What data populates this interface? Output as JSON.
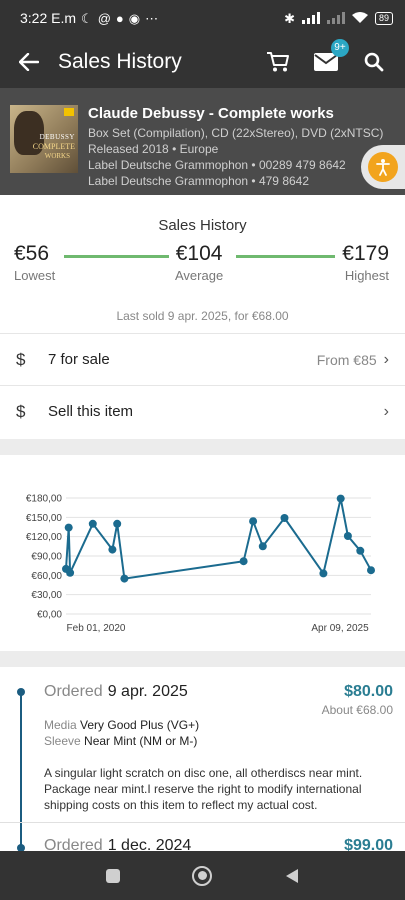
{
  "status_bar": {
    "time": "3:22 E.m",
    "overflow": "⋯",
    "battery": "89",
    "icons": [
      "moon-icon",
      "at-icon",
      "chat-icon",
      "record-icon",
      "bluetooth-icon",
      "signal-icon",
      "signal-icon",
      "wifi-icon",
      "battery-icon"
    ]
  },
  "app_bar": {
    "title": "Sales History",
    "notifications_badge": "9+",
    "icons": [
      "back-arrow-icon",
      "cart-icon",
      "mail-icon",
      "search-icon"
    ]
  },
  "release": {
    "title": "Claude Debussy - Complete works",
    "format": "Box Set (Compilation), CD (22xStereo), DVD (2xNTSC)",
    "released": "Released 2018 • Europe",
    "label1": "Label Deutsche Grammophon • 00289 479 8642",
    "label2": "Label Deutsche Grammophon • 479 8642",
    "cover_text": [
      "DEBUSSY",
      "COMPLETE",
      "WORKS"
    ]
  },
  "summary": {
    "heading": "Sales History",
    "lowest_value": "€56",
    "lowest_label": "Lowest",
    "average_value": "€104",
    "average_label": "Average",
    "highest_value": "€179",
    "highest_label": "Highest",
    "last_sold": "Last sold 9 apr. 2025, for €68.00",
    "accent_color": "#6fb96f"
  },
  "for_sale": {
    "icon": "$",
    "text": "7 for sale",
    "right": "From €85",
    "chevron": "›"
  },
  "sell": {
    "icon": "$",
    "text": "Sell this item",
    "chevron": "›"
  },
  "chart_data": {
    "type": "line",
    "y_ticks": [
      "€180,00",
      "€150,00",
      "€120,00",
      "€90,00",
      "€60,00",
      "€30,00",
      "€0,00"
    ],
    "ylim": [
      0,
      180
    ],
    "x_ticks": [
      "Feb 01, 2020",
      "Apr 09, 2025"
    ],
    "x": [
      "2020-01-15",
      "2020-02-01",
      "2020-02-10",
      "2020-07-01",
      "2020-11-01",
      "2020-12-01",
      "2021-01-15",
      "2023-02-01",
      "2023-04-01",
      "2023-06-01",
      "2023-10-15",
      "2024-06-15",
      "2024-10-01",
      "2024-11-15",
      "2025-02-01",
      "2025-04-09"
    ],
    "values": [
      70,
      134,
      64,
      140,
      100,
      140,
      55,
      82,
      144,
      105,
      149,
      63,
      179,
      121,
      98,
      68
    ],
    "line_color": "#1b6b8f",
    "grid": true
  },
  "orders": [
    {
      "label": "Ordered",
      "date": "9 apr. 2025",
      "price": "$80.00",
      "about": "About €68.00",
      "media_label": "Media",
      "media": "Very Good Plus (VG+)",
      "sleeve_label": "Sleeve",
      "sleeve": "Near Mint (NM or M-)",
      "comment": "A singular light scratch on disc one, all otherdiscs near mint. Package near mint.I reserve the right to modify international shipping costs on this item to reflect my actual cost."
    },
    {
      "label": "Ordered",
      "date": "1 dec. 2024",
      "price": "$99.00"
    }
  ]
}
